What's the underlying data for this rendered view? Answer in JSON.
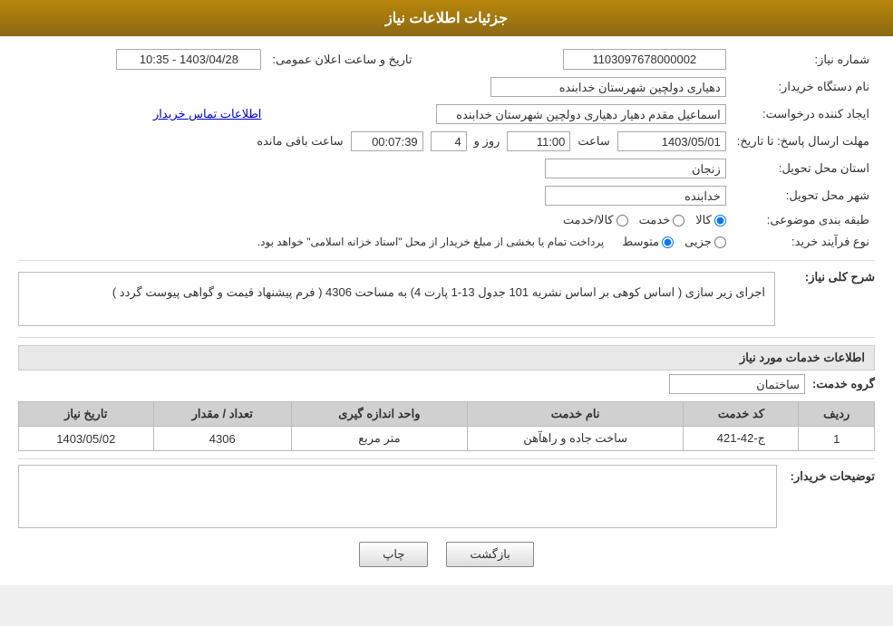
{
  "header": {
    "title": "جزئیات اطلاعات نیاز"
  },
  "fields": {
    "order_number_label": "شماره نیاز:",
    "order_number_value": "1103097678000002",
    "org_label": "نام دستگاه خریدار:",
    "org_value": "دهیاری دولچین شهرستان خدابنده",
    "creator_label": "ایجاد کننده درخواست:",
    "creator_value": "اسماعیل مقدم دهیار دهیاری دولچین شهرستان خدابنده",
    "contact_link": "اطلاعات تماس خریدار",
    "deadline_label": "مهلت ارسال پاسخ: تا تاریخ:",
    "deadline_date": "1403/05/01",
    "deadline_time_label": "ساعت",
    "deadline_time_value": "11:00",
    "deadline_day_label": "روز و",
    "deadline_days": "4",
    "deadline_remaining_label": "ساعت باقی مانده",
    "deadline_remaining_value": "00:07:39",
    "province_label": "استان محل تحویل:",
    "province_value": "زنجان",
    "city_label": "شهر محل تحویل:",
    "city_value": "خدابنده",
    "category_label": "طبقه بندی موضوعی:",
    "category_options": [
      "کالا",
      "خدمت",
      "کالا/خدمت"
    ],
    "category_selected": "کالا",
    "process_label": "نوع فرآیند خرید:",
    "process_options": [
      "جزیی",
      "متوسط"
    ],
    "process_selected": "متوسط",
    "process_note": "پرداخت تمام یا بخشی از مبلغ خریدار از محل \"اسناد خزانه اسلامی\" خواهد بود.",
    "public_date_label": "تاریخ و ساعت اعلان عمومی:",
    "public_date_value": "1403/04/28 - 10:35",
    "description_section": "شرح کلی نیاز:",
    "description_text": "اجرای زیر سازی ( اساس کوهی بر اساس نشریه 101 جدول 13-1 پارت 4) به مساحت 4306 ( فرم پیشنهاد قیمت و گواهی پیوست گردد )",
    "services_section": "اطلاعات خدمات مورد نیاز",
    "service_group_label": "گروه خدمت:",
    "service_group_value": "ساختمان",
    "table": {
      "headers": [
        "ردیف",
        "کد خدمت",
        "نام خدمت",
        "واحد اندازه گیری",
        "تعداد / مقدار",
        "تاریخ نیاز"
      ],
      "rows": [
        {
          "row": "1",
          "code": "ج-42-421",
          "name": "ساخت جاده و راهآهن",
          "unit": "متر مربع",
          "quantity": "4306",
          "date": "1403/05/02"
        }
      ]
    },
    "buyer_comment_label": "توضیحات خریدار:",
    "buyer_comment_value": ""
  },
  "buttons": {
    "print_label": "چاپ",
    "back_label": "بازگشت"
  }
}
